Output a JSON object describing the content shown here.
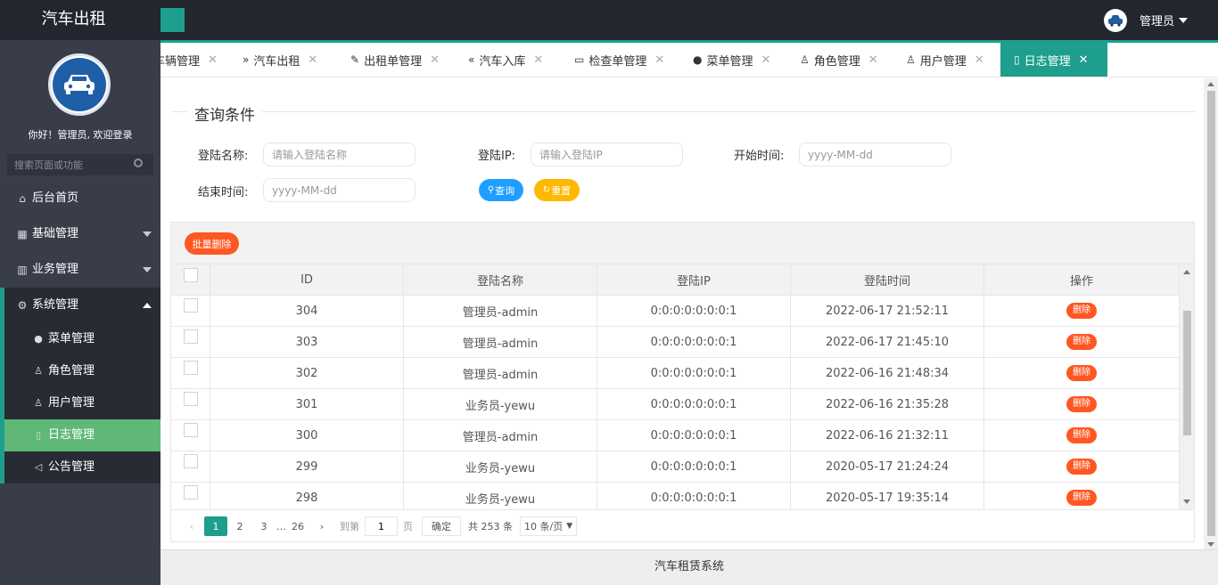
{
  "app": {
    "title": "汽车出租"
  },
  "header": {
    "user_label": "管理员"
  },
  "sidebar": {
    "welcome": "你好！管理员, 欢迎登录",
    "search_placeholder": "搜索页面或功能",
    "menu": [
      {
        "label": "后台首页",
        "icon": "home-icon"
      },
      {
        "label": "基础管理",
        "icon": "grid-icon"
      },
      {
        "label": "业务管理",
        "icon": "business-icon"
      },
      {
        "label": "系统管理",
        "icon": "gear-icon"
      }
    ],
    "submenu": [
      {
        "label": "菜单管理",
        "icon": "circle-icon"
      },
      {
        "label": "角色管理",
        "icon": "person-icon"
      },
      {
        "label": "用户管理",
        "icon": "users-icon"
      },
      {
        "label": "日志管理",
        "icon": "log-icon"
      },
      {
        "label": "公告管理",
        "icon": "speaker-icon"
      }
    ]
  },
  "tabs": [
    {
      "label": "车辆管理",
      "icon": ""
    },
    {
      "label": "汽车出租",
      "icon": "double-chevron-icon"
    },
    {
      "label": "出租单管理",
      "icon": "edit-icon"
    },
    {
      "label": "汽车入库",
      "icon": "double-chevron-left-icon"
    },
    {
      "label": "检查单管理",
      "icon": "book-icon"
    },
    {
      "label": "菜单管理",
      "icon": "circle-icon"
    },
    {
      "label": "角色管理",
      "icon": "person-icon"
    },
    {
      "label": "用户管理",
      "icon": "users-icon"
    },
    {
      "label": "日志管理",
      "icon": "log-icon"
    }
  ],
  "query": {
    "legend": "查询条件",
    "login_name_label": "登陆名称:",
    "login_name_placeholder": "请输入登陆名称",
    "login_ip_label": "登陆IP:",
    "login_ip_placeholder": "请输入登陆IP",
    "start_time_label": "开始时间:",
    "start_time_placeholder": "yyyy-MM-dd",
    "end_time_label": "结束时间:",
    "end_time_placeholder": "yyyy-MM-dd",
    "search_label": "查询",
    "reset_label": "重置"
  },
  "table": {
    "batch_delete_label": "批量删除",
    "columns": [
      "ID",
      "登陆名称",
      "登陆IP",
      "登陆时间",
      "操作"
    ],
    "rows": [
      {
        "id": "304",
        "name": "管理员-admin",
        "ip": "0:0:0:0:0:0:0:1",
        "time": "2022-06-17 21:52:11"
      },
      {
        "id": "303",
        "name": "管理员-admin",
        "ip": "0:0:0:0:0:0:0:1",
        "time": "2022-06-17 21:45:10"
      },
      {
        "id": "302",
        "name": "管理员-admin",
        "ip": "0:0:0:0:0:0:0:1",
        "time": "2022-06-16 21:48:34"
      },
      {
        "id": "301",
        "name": "业务员-yewu",
        "ip": "0:0:0:0:0:0:0:1",
        "time": "2022-06-16 21:35:28"
      },
      {
        "id": "300",
        "name": "管理员-admin",
        "ip": "0:0:0:0:0:0:0:1",
        "time": "2022-06-16 21:32:11"
      },
      {
        "id": "299",
        "name": "业务员-yewu",
        "ip": "0:0:0:0:0:0:0:1",
        "time": "2020-05-17 21:24:24"
      },
      {
        "id": "298",
        "name": "业务员-yewu",
        "ip": "0:0:0:0:0:0:0:1",
        "time": "2020-05-17 19:35:14"
      }
    ],
    "row_action_label": "删除"
  },
  "pager": {
    "pages": [
      "1",
      "2",
      "3"
    ],
    "ellipsis": "…",
    "last_page": "26",
    "goto_label": "到第",
    "goto_value": "1",
    "page_unit": "页",
    "confirm_label": "确定",
    "total_text": "共 253 条",
    "page_size": "10 条/页"
  },
  "footer": {
    "text": "汽车租赁系统"
  },
  "colors": {
    "teal": "#1e9e8c",
    "header": "#23262e",
    "sidebar": "#393d49",
    "active_green": "#5fb878",
    "danger": "#ff5722",
    "search_blue": "#1e9fff",
    "reset_yellow": "#ffb800"
  }
}
